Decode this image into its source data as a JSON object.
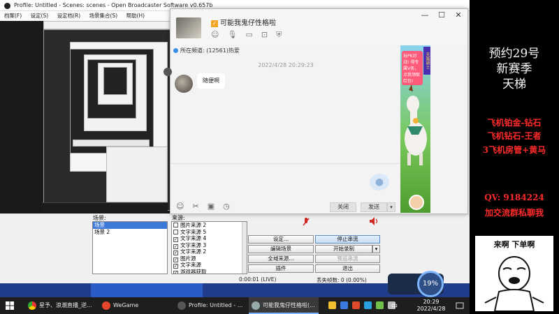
{
  "obs": {
    "title": "Profile: Untitled - Scenes: scenes - Open Broadcaster Software v0.657b",
    "menu": [
      "档案(F)",
      "设定(S)",
      "设定档(R)",
      "场景集合(S)",
      "帮助(H)"
    ],
    "scenes_label": "场景:",
    "scenes": [
      "场景",
      "场景 2"
    ],
    "sources_label": "来源:",
    "sources": [
      {
        "label": "图片来源 2",
        "checked": false
      },
      {
        "label": "文字来源 5",
        "checked": false
      },
      {
        "label": "文字来源 4",
        "checked": true
      },
      {
        "label": "文字来源 3",
        "checked": true
      },
      {
        "label": "文字来源 2",
        "checked": true
      },
      {
        "label": "图片源",
        "checked": true
      },
      {
        "label": "文字来源",
        "checked": true
      },
      {
        "label": "游戏器获取",
        "checked": true
      }
    ],
    "buttons": {
      "settings": "设定...",
      "stop_stream": "停止串流",
      "edit_scene": "编辑场景",
      "start_record": "开始录制",
      "global_sources": "全域来源...",
      "preview_stream": "预览串流",
      "plugins": "插件",
      "exit": "退出"
    },
    "status": {
      "time": "0:00:01 (LIVE)",
      "dropped_frames": "丢失帧数: 0 (0.00%)"
    },
    "tray_gauge": "19%"
  },
  "qq": {
    "title": "可能我鬼仔性格啦",
    "group_notice": "所在频道: (12561)热爱",
    "timestamp": "2022/4/28 20:29:23",
    "message": "随便啊",
    "close_button": "关闭",
    "send_button": "发送",
    "ad_text": "玩PK对战! 得专属V务，点我领取红包!",
    "ad_side": "天策骑士"
  },
  "overlay": {
    "line1": "预约29号",
    "line2": "新赛季",
    "line3": "天梯",
    "red1": "飞机铂金-钻石",
    "red2": "飞机钻石-王者",
    "red3": "3飞机房管+黄马",
    "qq": "QV:  9184224",
    "group": "加交流群私聊我",
    "meme": "来啊 下单啊"
  },
  "taskbar": {
    "items": [
      {
        "label": "星予、浪潮直播_逆..."
      },
      {
        "label": "WeGame"
      },
      {
        "label": "Profile: Untitled - ..."
      },
      {
        "label": "可能我鬼仔性格啦(..."
      }
    ],
    "clock_time": "20:29",
    "clock_date": "2022/4/28",
    "ime": "中"
  },
  "colors": {
    "accent_blue": "#3d79d8",
    "meter_red": "#d0281f",
    "overlay_red": "#ff2a2a"
  }
}
